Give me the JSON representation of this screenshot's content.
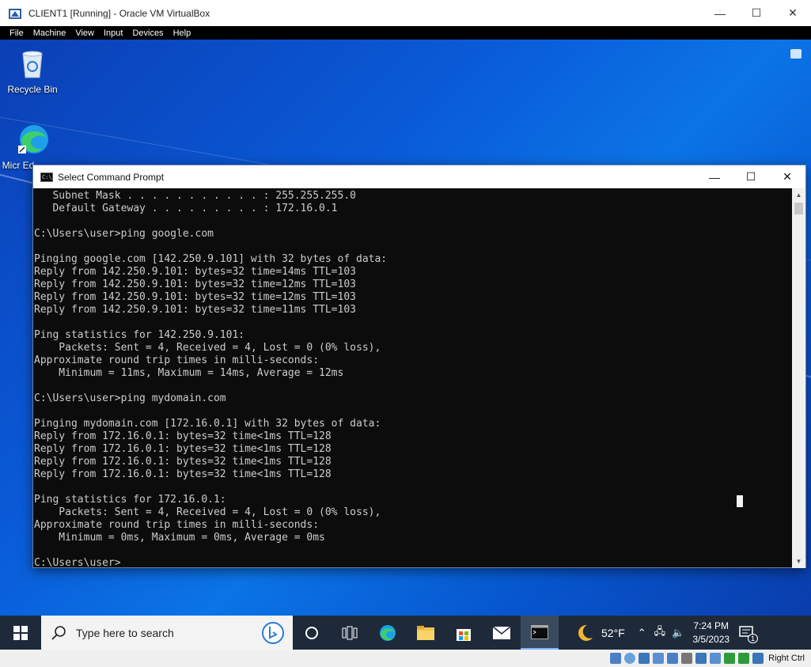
{
  "host_window": {
    "title": "CLIENT1 [Running] - Oracle VM VirtualBox",
    "menu": [
      "File",
      "Machine",
      "View",
      "Input",
      "Devices",
      "Help"
    ],
    "controls": {
      "minimize": "—",
      "maximize": "☐",
      "close": "✕"
    }
  },
  "desktop": {
    "icons": [
      {
        "label": "Recycle Bin",
        "icon": "recycle-bin-icon"
      },
      {
        "label": "Micr Ed",
        "icon": "edge-icon"
      }
    ]
  },
  "cmd_window": {
    "title": "Select Command Prompt",
    "icon_text": "C:\\",
    "lines": [
      "   Subnet Mask . . . . . . . . . . . : 255.255.255.0",
      "   Default Gateway . . . . . . . . . : 172.16.0.1",
      "",
      "C:\\Users\\user>ping google.com",
      "",
      "Pinging google.com [142.250.9.101] with 32 bytes of data:",
      "Reply from 142.250.9.101: bytes=32 time=14ms TTL=103",
      "Reply from 142.250.9.101: bytes=32 time=12ms TTL=103",
      "Reply from 142.250.9.101: bytes=32 time=12ms TTL=103",
      "Reply from 142.250.9.101: bytes=32 time=11ms TTL=103",
      "",
      "Ping statistics for 142.250.9.101:",
      "    Packets: Sent = 4, Received = 4, Lost = 0 (0% loss),",
      "Approximate round trip times in milli-seconds:",
      "    Minimum = 11ms, Maximum = 14ms, Average = 12ms",
      "",
      "C:\\Users\\user>ping mydomain.com",
      "",
      "Pinging mydomain.com [172.16.0.1] with 32 bytes of data:",
      "Reply from 172.16.0.1: bytes=32 time<1ms TTL=128",
      "Reply from 172.16.0.1: bytes=32 time<1ms TTL=128",
      "Reply from 172.16.0.1: bytes=32 time<1ms TTL=128",
      "Reply from 172.16.0.1: bytes=32 time<1ms TTL=128",
      "",
      "Ping statistics for 172.16.0.1:",
      "    Packets: Sent = 4, Received = 4, Lost = 0 (0% loss),",
      "Approximate round trip times in milli-seconds:",
      "    Minimum = 0ms, Maximum = 0ms, Average = 0ms",
      "",
      "C:\\Users\\user>"
    ]
  },
  "taskbar": {
    "search_placeholder": "Type here to search",
    "apps": [
      "task-view-icon",
      "edge-icon",
      "file-explorer-icon",
      "store-icon",
      "mail-icon",
      "command-prompt-icon"
    ],
    "weather_temp": "52°F",
    "time": "7:24 PM",
    "date": "3/5/2023",
    "notification_count": "1"
  },
  "status_bar": {
    "host_key": "Right Ctrl"
  },
  "colors": {
    "console_bg": "#0c0c0c",
    "console_fg": "#cccccc",
    "taskbar_bg": "#1e2a3a",
    "desktop_blue": "#0a5bd8"
  }
}
